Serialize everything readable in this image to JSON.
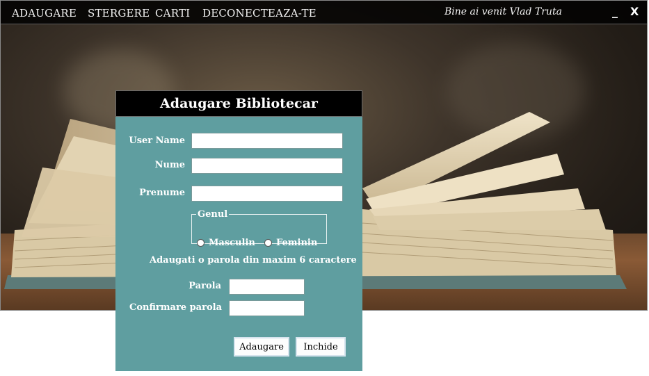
{
  "menu": {
    "items": [
      "ADAUGARE",
      "STERGERE",
      "CARTI",
      "DECONECTEAZA-TE"
    ],
    "welcome": "Bine ai venit Vlad Truta",
    "minimize": "_",
    "close": "X"
  },
  "dialog": {
    "title": "Adaugare Bibliotecar",
    "username_label": "User Name",
    "nume_label": "Nume",
    "prenume_label": "Prenume",
    "username_value": "",
    "nume_value": "",
    "prenume_value": "",
    "gender_group_label": "Genul",
    "gender_options": [
      "Masculin",
      "Feminin"
    ],
    "password_hint": "Adaugati o parola din maxim 6 caractere",
    "parola_label": "Parola",
    "confirm_label": "Confirmare parola",
    "add_button": "Adaugare",
    "close_button": "Inchide"
  },
  "colors": {
    "dialog_bg": "#5f9ea0",
    "menubar_bg": "#000000",
    "header_bg": "#000000"
  }
}
